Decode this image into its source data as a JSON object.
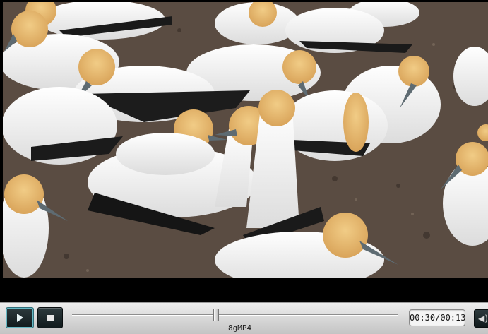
{
  "player": {
    "file_name": "8gMP4",
    "time_display": "00:30/00:13",
    "progress_fraction": 0.44,
    "play_icon": "play-icon",
    "stop_icon": "stop-icon",
    "volume_icon": "speaker-icon",
    "volume_glyph": "◀)"
  }
}
